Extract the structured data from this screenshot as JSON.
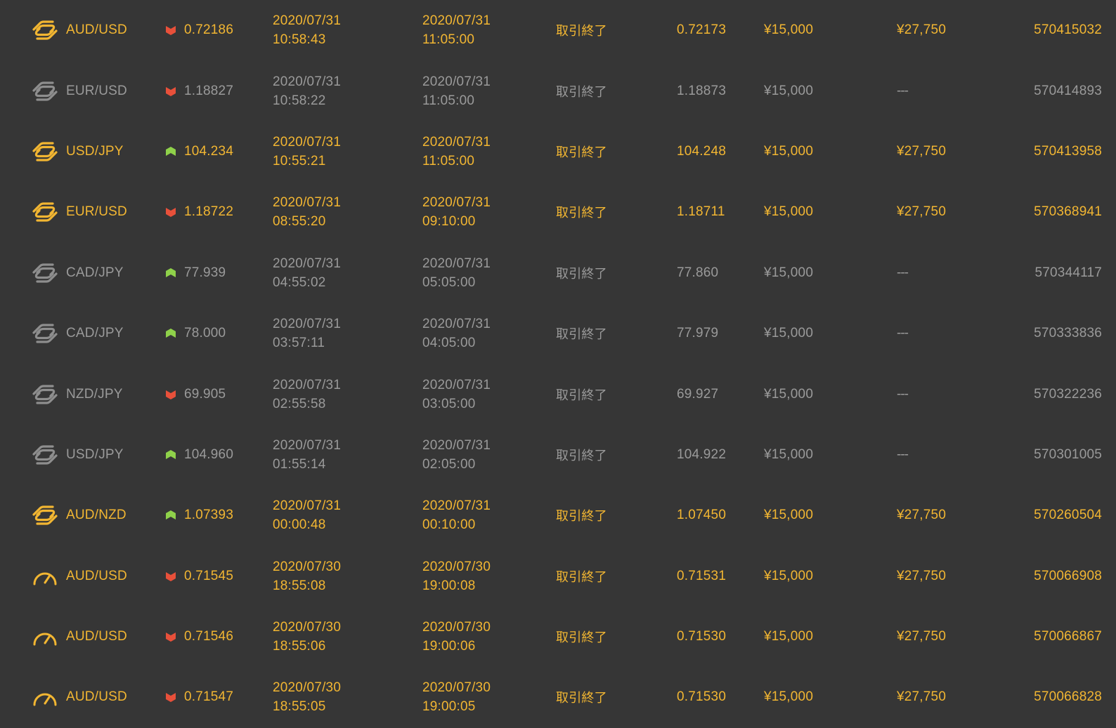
{
  "colors": {
    "background": "#363636",
    "win_text": "#f2b632",
    "lose_text": "#9a9a9a",
    "high_arrow": "#8fd14a",
    "low_arrow": "#e8503a"
  },
  "trades": [
    {
      "result": "win",
      "type_icon": "exchange-icon",
      "pair": "AUD/USD",
      "direction": "low",
      "entry_rate": "0.72186",
      "entry_date": "2020/07/31",
      "entry_time": "10:58:43",
      "judge_date": "2020/07/31",
      "judge_time": "11:05:00",
      "status": "取引終了",
      "judge_rate": "0.72173",
      "purchase": "¥15,000",
      "payout": "¥27,750",
      "order_id": "570415032"
    },
    {
      "result": "lose",
      "type_icon": "exchange-icon",
      "pair": "EUR/USD",
      "direction": "low",
      "entry_rate": "1.18827",
      "entry_date": "2020/07/31",
      "entry_time": "10:58:22",
      "judge_date": "2020/07/31",
      "judge_time": "11:05:00",
      "status": "取引終了",
      "judge_rate": "1.18873",
      "purchase": "¥15,000",
      "payout": "---",
      "order_id": "570414893"
    },
    {
      "result": "win",
      "type_icon": "exchange-icon",
      "pair": "USD/JPY",
      "direction": "high",
      "entry_rate": "104.234",
      "entry_date": "2020/07/31",
      "entry_time": "10:55:21",
      "judge_date": "2020/07/31",
      "judge_time": "11:05:00",
      "status": "取引終了",
      "judge_rate": "104.248",
      "purchase": "¥15,000",
      "payout": "¥27,750",
      "order_id": "570413958"
    },
    {
      "result": "win",
      "type_icon": "exchange-icon",
      "pair": "EUR/USD",
      "direction": "low",
      "entry_rate": "1.18722",
      "entry_date": "2020/07/31",
      "entry_time": "08:55:20",
      "judge_date": "2020/07/31",
      "judge_time": "09:10:00",
      "status": "取引終了",
      "judge_rate": "1.18711",
      "purchase": "¥15,000",
      "payout": "¥27,750",
      "order_id": "570368941"
    },
    {
      "result": "lose",
      "type_icon": "exchange-icon",
      "pair": "CAD/JPY",
      "direction": "high",
      "entry_rate": "77.939",
      "entry_date": "2020/07/31",
      "entry_time": "04:55:02",
      "judge_date": "2020/07/31",
      "judge_time": "05:05:00",
      "status": "取引終了",
      "judge_rate": "77.860",
      "purchase": "¥15,000",
      "payout": "---",
      "order_id": "570344117"
    },
    {
      "result": "lose",
      "type_icon": "exchange-icon",
      "pair": "CAD/JPY",
      "direction": "high",
      "entry_rate": "78.000",
      "entry_date": "2020/07/31",
      "entry_time": "03:57:11",
      "judge_date": "2020/07/31",
      "judge_time": "04:05:00",
      "status": "取引終了",
      "judge_rate": "77.979",
      "purchase": "¥15,000",
      "payout": "---",
      "order_id": "570333836"
    },
    {
      "result": "lose",
      "type_icon": "exchange-icon",
      "pair": "NZD/JPY",
      "direction": "low",
      "entry_rate": "69.905",
      "entry_date": "2020/07/31",
      "entry_time": "02:55:58",
      "judge_date": "2020/07/31",
      "judge_time": "03:05:00",
      "status": "取引終了",
      "judge_rate": "69.927",
      "purchase": "¥15,000",
      "payout": "---",
      "order_id": "570322236"
    },
    {
      "result": "lose",
      "type_icon": "exchange-icon",
      "pair": "USD/JPY",
      "direction": "high",
      "entry_rate": "104.960",
      "entry_date": "2020/07/31",
      "entry_time": "01:55:14",
      "judge_date": "2020/07/31",
      "judge_time": "02:05:00",
      "status": "取引終了",
      "judge_rate": "104.922",
      "purchase": "¥15,000",
      "payout": "---",
      "order_id": "570301005"
    },
    {
      "result": "win",
      "type_icon": "exchange-icon",
      "pair": "AUD/NZD",
      "direction": "high",
      "entry_rate": "1.07393",
      "entry_date": "2020/07/31",
      "entry_time": "00:00:48",
      "judge_date": "2020/07/31",
      "judge_time": "00:10:00",
      "status": "取引終了",
      "judge_rate": "1.07450",
      "purchase": "¥15,000",
      "payout": "¥27,750",
      "order_id": "570260504"
    },
    {
      "result": "win",
      "type_icon": "speedometer-icon",
      "pair": "AUD/USD",
      "direction": "low",
      "entry_rate": "0.71545",
      "entry_date": "2020/07/30",
      "entry_time": "18:55:08",
      "judge_date": "2020/07/30",
      "judge_time": "19:00:08",
      "status": "取引終了",
      "judge_rate": "0.71531",
      "purchase": "¥15,000",
      "payout": "¥27,750",
      "order_id": "570066908"
    },
    {
      "result": "win",
      "type_icon": "speedometer-icon",
      "pair": "AUD/USD",
      "direction": "low",
      "entry_rate": "0.71546",
      "entry_date": "2020/07/30",
      "entry_time": "18:55:06",
      "judge_date": "2020/07/30",
      "judge_time": "19:00:06",
      "status": "取引終了",
      "judge_rate": "0.71530",
      "purchase": "¥15,000",
      "payout": "¥27,750",
      "order_id": "570066867"
    },
    {
      "result": "win",
      "type_icon": "speedometer-icon",
      "pair": "AUD/USD",
      "direction": "low",
      "entry_rate": "0.71547",
      "entry_date": "2020/07/30",
      "entry_time": "18:55:05",
      "judge_date": "2020/07/30",
      "judge_time": "19:00:05",
      "status": "取引終了",
      "judge_rate": "0.71530",
      "purchase": "¥15,000",
      "payout": "¥27,750",
      "order_id": "570066828"
    }
  ]
}
